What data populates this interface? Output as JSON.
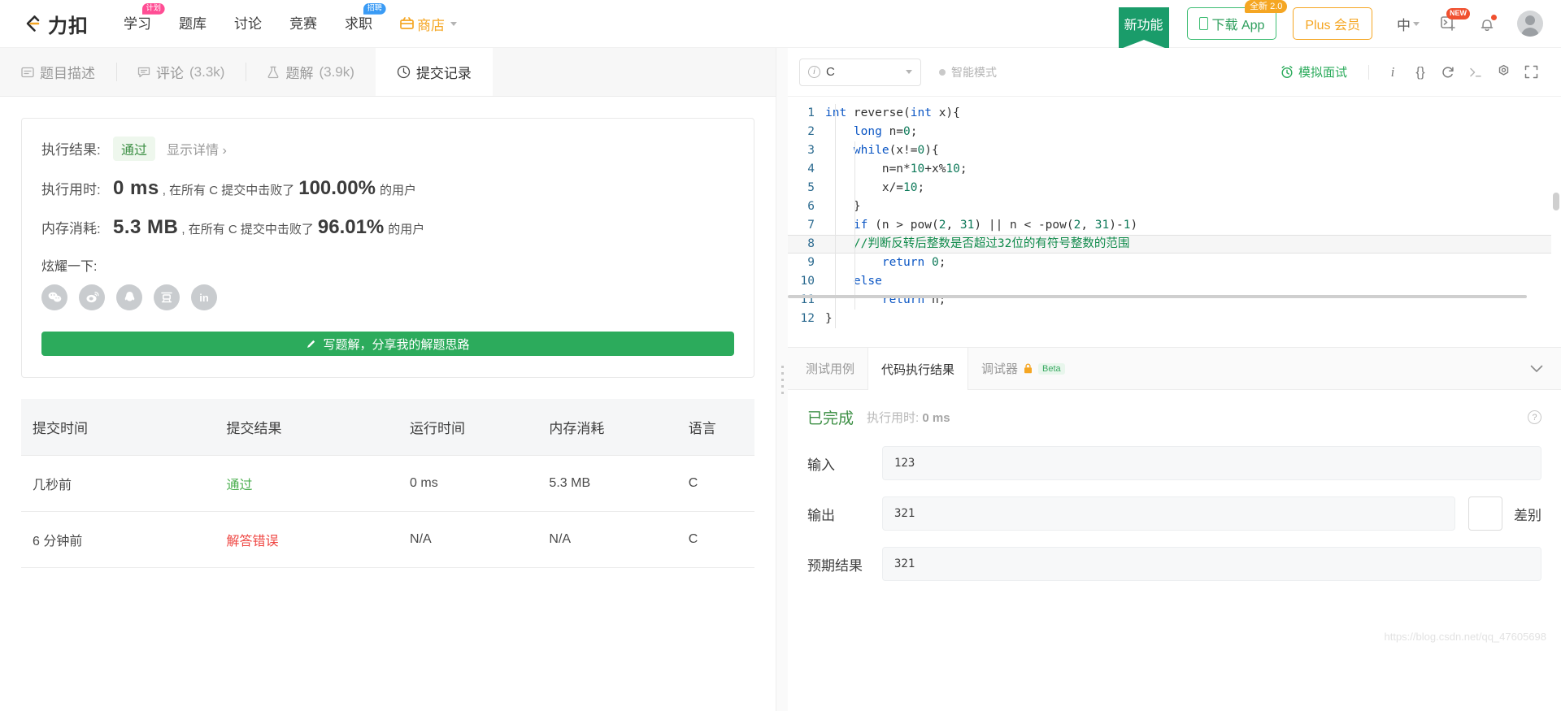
{
  "header": {
    "logo_text": "力扣",
    "nav": [
      {
        "label": "学习",
        "badge": "计划",
        "badge_color": "#ff4d94"
      },
      {
        "label": "题库",
        "badge": "",
        "badge_color": ""
      },
      {
        "label": "讨论",
        "badge": "",
        "badge_color": ""
      },
      {
        "label": "竞赛",
        "badge": "",
        "badge_color": ""
      },
      {
        "label": "求职",
        "badge": "招聘",
        "badge_color": "#3a9bf5"
      }
    ],
    "shop_label": "商店",
    "ribbon_label": "新功能",
    "download_label": "下载 App",
    "download_badge": "全新 2.0",
    "plus_label": "Plus 会员",
    "lang_label": "中",
    "new_pill": "NEW",
    "accent_green": "#2cab5c",
    "accent_orange": "#f5a623"
  },
  "tabs": [
    {
      "label": "题目描述",
      "icon": "description-icon",
      "count": "",
      "active": false
    },
    {
      "label": "评论",
      "icon": "comment-icon",
      "count": "(3.3k)",
      "active": false
    },
    {
      "label": "题解",
      "icon": "flask-icon",
      "count": "(3.9k)",
      "active": false
    },
    {
      "label": "提交记录",
      "icon": "clock-icon",
      "count": "",
      "active": true
    }
  ],
  "result": {
    "status_label": "执行结果:",
    "status_value": "通过",
    "details_link": "显示详情 ›",
    "runtime_label": "执行用时:",
    "runtime_value": "0 ms",
    "runtime_desc_pre": ", 在所有 C 提交中击败了",
    "runtime_percent": "100.00%",
    "runtime_desc_post": "的用户",
    "memory_label": "内存消耗:",
    "memory_value": "5.3 MB",
    "memory_desc_pre": ", 在所有 C 提交中击败了",
    "memory_percent": "96.01%",
    "memory_desc_post": "的用户",
    "share_label": "炫耀一下:",
    "share_icons": [
      {
        "name": "wechat-icon",
        "glyph": "✆"
      },
      {
        "name": "weibo-icon",
        "glyph": "◉"
      },
      {
        "name": "qq-icon",
        "glyph": "♧"
      },
      {
        "name": "douban-icon",
        "glyph": "豆"
      },
      {
        "name": "linkedin-icon",
        "glyph": "in"
      }
    ],
    "write_solution_button": "写题解，分享我的解题思路"
  },
  "submissions": {
    "columns": [
      "提交时间",
      "提交结果",
      "运行时间",
      "内存消耗",
      "语言"
    ],
    "rows": [
      {
        "time": "几秒前",
        "result": "通过",
        "result_state": "accepted",
        "runtime": "0 ms",
        "memory": "5.3 MB",
        "language": "C"
      },
      {
        "time": "6 分钟前",
        "result": "解答错误",
        "result_state": "wrong",
        "runtime": "N/A",
        "memory": "N/A",
        "language": "C"
      }
    ]
  },
  "editor": {
    "language": "C",
    "smart_mode": "智能模式",
    "mock_interview": "模拟面试",
    "toolbar_icons": [
      "info-icon",
      "braces-icon",
      "reset-icon",
      "console-icon",
      "settings-icon",
      "fullscreen-icon"
    ],
    "code_lines": [
      {
        "n": "1",
        "tokens": [
          {
            "t": "int ",
            "c": "k"
          },
          {
            "t": "reverse(",
            "c": ""
          },
          {
            "t": "int ",
            "c": "k"
          },
          {
            "t": "x){",
            "c": ""
          }
        ]
      },
      {
        "n": "2",
        "tokens": [
          {
            "t": "    ",
            "c": ""
          },
          {
            "t": "long ",
            "c": "k"
          },
          {
            "t": "n=",
            "c": ""
          },
          {
            "t": "0",
            "c": "num"
          },
          {
            "t": ";",
            "c": ""
          }
        ]
      },
      {
        "n": "3",
        "tokens": [
          {
            "t": "    ",
            "c": ""
          },
          {
            "t": "while",
            "c": "k"
          },
          {
            "t": "(x!=",
            "c": ""
          },
          {
            "t": "0",
            "c": "num"
          },
          {
            "t": "){",
            "c": ""
          }
        ]
      },
      {
        "n": "4",
        "tokens": [
          {
            "t": "        n=n*",
            "c": ""
          },
          {
            "t": "10",
            "c": "num"
          },
          {
            "t": "+x%",
            "c": ""
          },
          {
            "t": "10",
            "c": "num"
          },
          {
            "t": ";",
            "c": ""
          }
        ]
      },
      {
        "n": "5",
        "tokens": [
          {
            "t": "        x/=",
            "c": ""
          },
          {
            "t": "10",
            "c": "num"
          },
          {
            "t": ";",
            "c": ""
          }
        ]
      },
      {
        "n": "6",
        "tokens": [
          {
            "t": "    }",
            "c": ""
          }
        ]
      },
      {
        "n": "7",
        "tokens": [
          {
            "t": "    ",
            "c": ""
          },
          {
            "t": "if",
            "c": "k"
          },
          {
            "t": " (n > pow(",
            "c": ""
          },
          {
            "t": "2",
            "c": "num"
          },
          {
            "t": ", ",
            "c": ""
          },
          {
            "t": "31",
            "c": "num"
          },
          {
            "t": ") || n < -pow(",
            "c": ""
          },
          {
            "t": "2",
            "c": "num"
          },
          {
            "t": ", ",
            "c": ""
          },
          {
            "t": "31",
            "c": "num"
          },
          {
            "t": ")-",
            "c": ""
          },
          {
            "t": "1",
            "c": "num"
          },
          {
            "t": ")",
            "c": ""
          }
        ]
      },
      {
        "n": "8",
        "highlight": true,
        "tokens": [
          {
            "t": "    ",
            "c": ""
          },
          {
            "t": "//判断反转后整数是否超过32位的有符号整数的范围",
            "c": "cmt"
          }
        ]
      },
      {
        "n": "9",
        "tokens": [
          {
            "t": "        ",
            "c": ""
          },
          {
            "t": "return ",
            "c": "k"
          },
          {
            "t": "0",
            "c": "num"
          },
          {
            "t": ";",
            "c": ""
          }
        ]
      },
      {
        "n": "10",
        "tokens": [
          {
            "t": "    ",
            "c": ""
          },
          {
            "t": "else",
            "c": "k"
          }
        ]
      },
      {
        "n": "11",
        "tokens": [
          {
            "t": "        ",
            "c": ""
          },
          {
            "t": "return ",
            "c": "k"
          },
          {
            "t": "n;",
            "c": ""
          }
        ]
      },
      {
        "n": "12",
        "tokens": [
          {
            "t": "}",
            "c": ""
          }
        ]
      }
    ]
  },
  "console": {
    "tabs": [
      {
        "label": "测试用例",
        "active": false,
        "lock": false,
        "beta": ""
      },
      {
        "label": "代码执行结果",
        "active": true,
        "lock": false,
        "beta": ""
      },
      {
        "label": "调试器",
        "active": false,
        "lock": true,
        "beta": "Beta"
      }
    ],
    "status": "已完成",
    "runtime_label": "执行用时:",
    "runtime_value": "0 ms",
    "input_label": "输入",
    "input_value": "123",
    "output_label": "输出",
    "output_value": "321",
    "expected_label": "预期结果",
    "expected_value": "321",
    "diff_label": "差别"
  },
  "watermark": "https://blog.csdn.net/qq_47605698"
}
